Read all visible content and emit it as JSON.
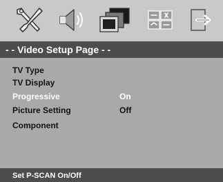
{
  "icon_bar": {
    "icons": [
      {
        "name": "general-setup-icon"
      },
      {
        "name": "audio-setup-icon"
      },
      {
        "name": "video-setup-icon"
      },
      {
        "name": "preference-setup-icon"
      },
      {
        "name": "exit-setup-icon"
      }
    ]
  },
  "title_bar": {
    "title": "- -  Video Setup Page  - -"
  },
  "menu": {
    "items": [
      {
        "label": "TV Type",
        "value": ""
      },
      {
        "label": "TV Display",
        "value": ""
      },
      {
        "label": "Progressive",
        "value": "On",
        "highlighted": true
      },
      {
        "label": "Picture Setting",
        "value": "Off"
      },
      {
        "label": "Component",
        "value": ""
      }
    ]
  },
  "status_bar": {
    "text": "Set P-SCAN On/Off"
  },
  "colors": {
    "background": "#c8c8c8",
    "menu_background": "#a9a9a9",
    "bar_background": "#4d4d4d",
    "highlight_text": "#ffffff",
    "normal_text": "#111111"
  }
}
